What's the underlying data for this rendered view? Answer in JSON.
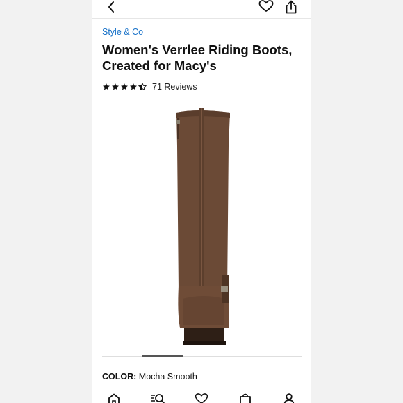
{
  "header": {
    "back_icon": "chevron-left-icon",
    "favorite_icon": "heart-icon",
    "share_icon": "share-icon"
  },
  "product": {
    "brand": "Style & Co",
    "title": "Women's Verrlee Riding Boots, Created for Macy's",
    "rating": 4.5,
    "reviews": "71 Reviews",
    "image_icon": "riding-boot-image",
    "carousel": {
      "active_index": 1
    }
  },
  "color": {
    "label": "COLOR:",
    "value": "Mocha Smooth"
  },
  "bottom_nav": [
    {
      "icon": "home-icon"
    },
    {
      "icon": "search-icon"
    },
    {
      "icon": "heart-icon"
    },
    {
      "icon": "bag-icon"
    },
    {
      "icon": "account-icon"
    }
  ],
  "colors": {
    "brand_link": "#1a73c9",
    "boot": "#6b4a36"
  }
}
